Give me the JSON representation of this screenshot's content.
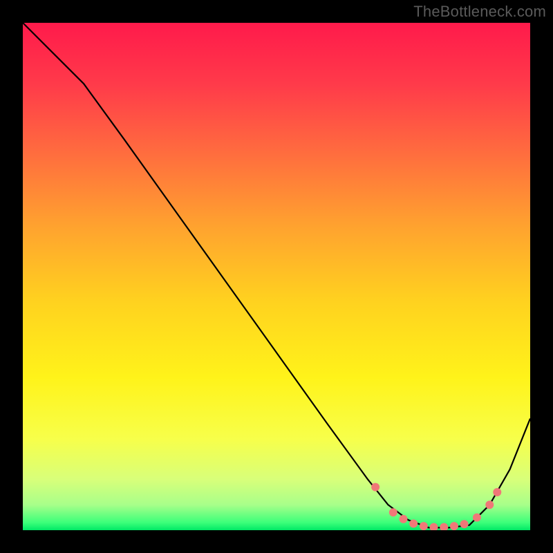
{
  "watermark": "TheBottleneck.com",
  "chart_data": {
    "type": "line",
    "title": "",
    "xlabel": "",
    "ylabel": "",
    "xlim": [
      0,
      100
    ],
    "ylim": [
      0,
      100
    ],
    "background_gradient": {
      "stops": [
        {
          "offset": 0.0,
          "color": "#ff1a4b"
        },
        {
          "offset": 0.12,
          "color": "#ff3a4a"
        },
        {
          "offset": 0.25,
          "color": "#ff6a3f"
        },
        {
          "offset": 0.4,
          "color": "#ffa22f"
        },
        {
          "offset": 0.55,
          "color": "#ffd21f"
        },
        {
          "offset": 0.7,
          "color": "#fff31a"
        },
        {
          "offset": 0.82,
          "color": "#f7ff4a"
        },
        {
          "offset": 0.9,
          "color": "#d8ff7a"
        },
        {
          "offset": 0.95,
          "color": "#a8ff8a"
        },
        {
          "offset": 0.985,
          "color": "#3cff7a"
        },
        {
          "offset": 1.0,
          "color": "#00e865"
        }
      ]
    },
    "series": [
      {
        "name": "bottleneck-curve",
        "color": "#000000",
        "x": [
          0,
          6,
          12,
          20,
          30,
          40,
          50,
          60,
          68,
          72,
          76,
          80,
          84,
          88,
          92,
          96,
          100
        ],
        "y": [
          100,
          94,
          88,
          77,
          63,
          49,
          35,
          21,
          10,
          5,
          2,
          0.5,
          0.5,
          1,
          5,
          12,
          22
        ]
      }
    ],
    "markers": {
      "name": "highlight-points",
      "color": "#f07878",
      "radius": 6,
      "x": [
        69.5,
        73,
        75,
        77,
        79,
        81,
        83,
        85,
        87,
        89.5,
        92,
        93.5
      ],
      "y": [
        8.5,
        3.5,
        2.2,
        1.3,
        0.8,
        0.6,
        0.6,
        0.8,
        1.2,
        2.5,
        5.0,
        7.5
      ]
    }
  }
}
